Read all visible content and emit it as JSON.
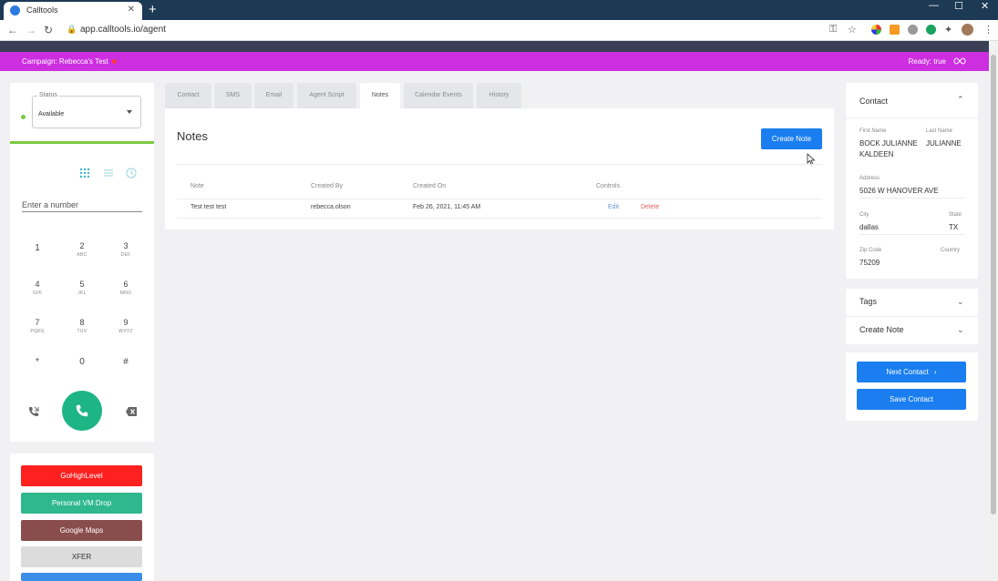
{
  "browser": {
    "tab_title": "Calltools",
    "tab_close": "✕",
    "new_tab": "+",
    "url": "app.calltools.io/agent",
    "minimize": "—",
    "maximize": "☐",
    "close": "✕"
  },
  "campaign_bar": {
    "campaign_text": "Campaign: Rebecca's Test",
    "ready_text": "Ready: true"
  },
  "dialer": {
    "status_label": "Status",
    "status_value": "Available",
    "number_placeholder": "Enter a number",
    "keys": [
      {
        "digit": "1",
        "letters": ""
      },
      {
        "digit": "2",
        "letters": "ABC"
      },
      {
        "digit": "3",
        "letters": "DEF"
      },
      {
        "digit": "4",
        "letters": "GHI"
      },
      {
        "digit": "5",
        "letters": "JKL"
      },
      {
        "digit": "6",
        "letters": "MNO"
      },
      {
        "digit": "7",
        "letters": "PQRS"
      },
      {
        "digit": "8",
        "letters": "TUV"
      },
      {
        "digit": "9",
        "letters": "WXYZ"
      },
      {
        "digit": "*",
        "letters": ""
      },
      {
        "digit": "0",
        "letters": ""
      },
      {
        "digit": "#",
        "letters": ""
      }
    ]
  },
  "quick_actions": [
    {
      "label": "GoHighLevel",
      "color": "#ff2020",
      "text_color": "#ffffff"
    },
    {
      "label": "Personal VM Drop",
      "color": "#2fb88e",
      "text_color": "#ffffff"
    },
    {
      "label": "Google Maps",
      "color": "#8a4d4d",
      "text_color": "#ffffff"
    },
    {
      "label": "XFER",
      "color": "#dcdcdc",
      "text_color": "#333333"
    },
    {
      "label": "",
      "color": "#3a8ee8",
      "text_color": "#ffffff"
    }
  ],
  "tabs": [
    "Contact",
    "SMS",
    "Email",
    "Agent Script",
    "Notes",
    "Calendar Events",
    "History"
  ],
  "notes": {
    "title": "Notes",
    "create_button": "Create Note",
    "columns": {
      "note": "Note",
      "created_by": "Created By",
      "created_on": "Created On",
      "controls": "Controls"
    },
    "rows": [
      {
        "note": "Test test test",
        "created_by": "rebecca.olson",
        "created_on": "Feb 26, 2021, 11:45 AM",
        "edit": "Edit",
        "delete": "Delete"
      }
    ]
  },
  "contact": {
    "title": "Contact",
    "first_name_label": "First Name",
    "first_name": "BOCK JULIANNE KALDEEN",
    "last_name_label": "Last Name",
    "last_name": "JULIANNE",
    "address_label": "Address",
    "address": "5026 W HANOVER AVE",
    "city_label": "City",
    "city": "dallas",
    "state_label": "State",
    "state": "TX",
    "zip_label": "Zip Code",
    "zip": "75209",
    "country_label": "Country",
    "country": ""
  },
  "accordions": {
    "tags": "Tags",
    "create_note": "Create Note"
  },
  "actions": {
    "next_contact": "Next Contact",
    "save_contact": "Save Contact"
  },
  "colors": {
    "campaign_bar": "#cc2ee0",
    "primary_blue": "#1a7ef0",
    "call_green": "#1db583",
    "status_green": "#7bc943",
    "delete_red": "#e0605a"
  }
}
